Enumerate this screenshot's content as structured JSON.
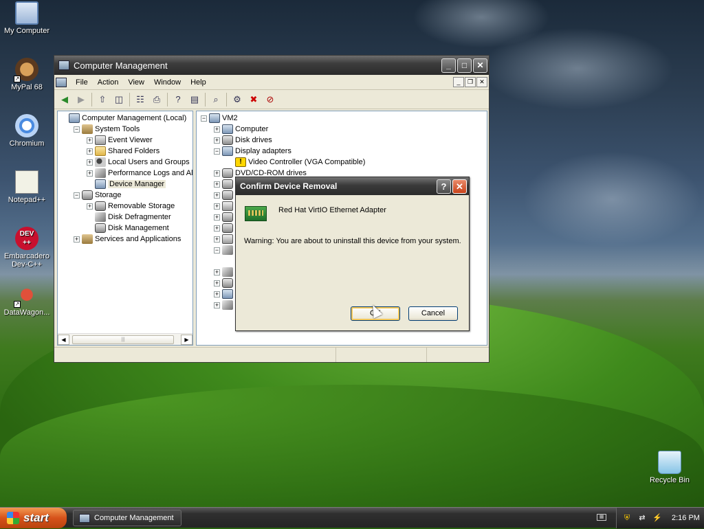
{
  "desktop": {
    "icons": [
      {
        "label": "My Computer",
        "icon": "computer-icon"
      },
      {
        "label": "MyPal 68",
        "icon": "mypal-icon"
      },
      {
        "label": "Chromium",
        "icon": "chromium-icon"
      },
      {
        "label": "Notepad++",
        "icon": "notepad-icon"
      },
      {
        "label": "Embarcadero Dev-C++",
        "icon": "devcpp-icon",
        "badge": "DEV\n++"
      },
      {
        "label": "DataWagon...",
        "icon": "datawagon-icon"
      },
      {
        "label": "Recycle Bin",
        "icon": "recycle-bin-icon"
      }
    ]
  },
  "window": {
    "title": "Computer Management",
    "menu": [
      "File",
      "Action",
      "View",
      "Window",
      "Help"
    ],
    "left_tree": [
      {
        "label": "Computer Management (Local)",
        "level": 0,
        "icon": "pc"
      },
      {
        "label": "System Tools",
        "level": 1,
        "icon": "tools",
        "expander": "−"
      },
      {
        "label": "Event Viewer",
        "level": 2,
        "icon": "log",
        "expander": "+"
      },
      {
        "label": "Shared Folders",
        "level": 2,
        "icon": "folder",
        "expander": "+"
      },
      {
        "label": "Local Users and Groups",
        "level": 2,
        "icon": "users",
        "expander": "+"
      },
      {
        "label": "Performance Logs and Alerts",
        "level": 2,
        "icon": "perf",
        "expander": "+"
      },
      {
        "label": "Device Manager",
        "level": 2,
        "icon": "pc",
        "selected": true
      },
      {
        "label": "Storage",
        "level": 1,
        "icon": "disk",
        "expander": "−"
      },
      {
        "label": "Removable Storage",
        "level": 2,
        "icon": "disk",
        "expander": "+"
      },
      {
        "label": "Disk Defragmenter",
        "level": 2,
        "icon": "perf"
      },
      {
        "label": "Disk Management",
        "level": 2,
        "icon": "disk"
      },
      {
        "label": "Services and Applications",
        "level": 1,
        "icon": "tools",
        "expander": "+"
      }
    ],
    "right_tree": [
      {
        "label": "VM2",
        "level": 0,
        "icon": "pc",
        "expander": "−"
      },
      {
        "label": "Computer",
        "level": 1,
        "icon": "pc",
        "expander": "+"
      },
      {
        "label": "Disk drives",
        "level": 1,
        "icon": "disk",
        "expander": "+"
      },
      {
        "label": "Display adapters",
        "level": 1,
        "icon": "pc",
        "expander": "−"
      },
      {
        "label": "Video Controller (VGA Compatible)",
        "level": 2,
        "icon": "warn"
      },
      {
        "label": "DVD/CD-ROM drives",
        "level": 1,
        "icon": "disk",
        "expander": "+"
      },
      {
        "label": "",
        "level": 1,
        "icon": "disk",
        "expander": "+"
      },
      {
        "label": "",
        "level": 1,
        "icon": "disk",
        "expander": "+"
      },
      {
        "label": "",
        "level": 1,
        "icon": "log",
        "expander": "+"
      },
      {
        "label": "",
        "level": 1,
        "icon": "disk",
        "expander": "+"
      },
      {
        "label": "",
        "level": 1,
        "icon": "disk",
        "expander": "+"
      },
      {
        "label": "",
        "level": 1,
        "icon": "log",
        "expander": "+"
      },
      {
        "label": "",
        "level": 1,
        "icon": "perf",
        "expander": "−"
      },
      {
        "label": "",
        "level": 2,
        "icon": "none"
      },
      {
        "label": "",
        "level": 1,
        "icon": "perf",
        "expander": "+"
      },
      {
        "label": "",
        "level": 1,
        "icon": "disk",
        "expander": "+"
      },
      {
        "label": "",
        "level": 1,
        "icon": "pc",
        "expander": "+"
      },
      {
        "label": "",
        "level": 1,
        "icon": "perf",
        "expander": "+"
      }
    ]
  },
  "dialog": {
    "title": "Confirm Device Removal",
    "device_name": "Red Hat VirtIO Ethernet Adapter",
    "warning": "Warning: You are about to uninstall this device from your system.",
    "ok_label": "OK",
    "cancel_label": "Cancel"
  },
  "taskbar": {
    "start_label": "start",
    "task_label": "Computer Management",
    "clock": "2:16 PM"
  }
}
